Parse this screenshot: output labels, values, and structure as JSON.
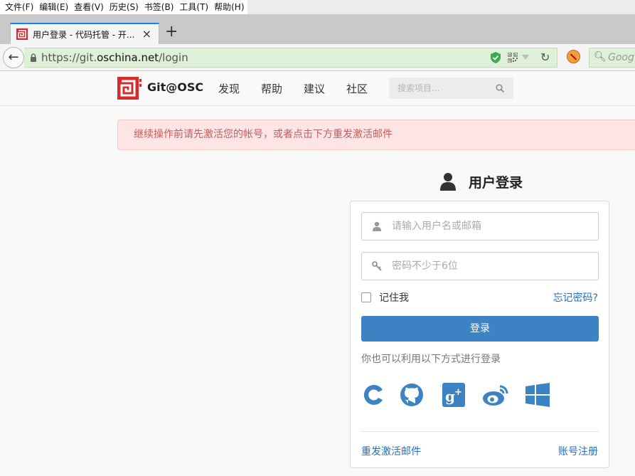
{
  "menu": [
    "文件(F)",
    "编辑(E)",
    "查看(V)",
    "历史(S)",
    "书签(B)",
    "工具(T)",
    "帮助(H)"
  ],
  "tab": {
    "title": "用户登录 - 代码托管 - 开...",
    "close": "×",
    "new_tab": "+"
  },
  "nav": {
    "back": "←",
    "url_prefix": "https://git.",
    "url_domain": "oschina.net",
    "url_path": "/login",
    "reload": "↻",
    "search_placeholder": "Goog"
  },
  "site": {
    "logo_text": "Git@OSC",
    "nav_items": [
      "发现",
      "帮助",
      "建议",
      "社区"
    ],
    "search_placeholder": "搜索项目..."
  },
  "alert": "继续操作前请先激活您的帐号，或者点击下方重发激活邮件",
  "login": {
    "title": "用户登录",
    "username_placeholder": "请输入用户名或邮箱",
    "password_placeholder": "密码不少于6位",
    "remember": "记住我",
    "forgot": "忘记密码?",
    "submit": "登录",
    "alt_text": "你也可以利用以下方式进行登录",
    "social": [
      "oschina-icon",
      "github-icon",
      "google-plus-icon",
      "weibo-icon",
      "windows-icon"
    ],
    "resend": "重发激活邮件",
    "register": "账号注册"
  },
  "colors": {
    "accent": "#3d83c3",
    "link": "#2a6ebb",
    "alert_bg": "#fde5e5",
    "alert_text": "#c65b5b",
    "brand": "#d52b2b"
  }
}
